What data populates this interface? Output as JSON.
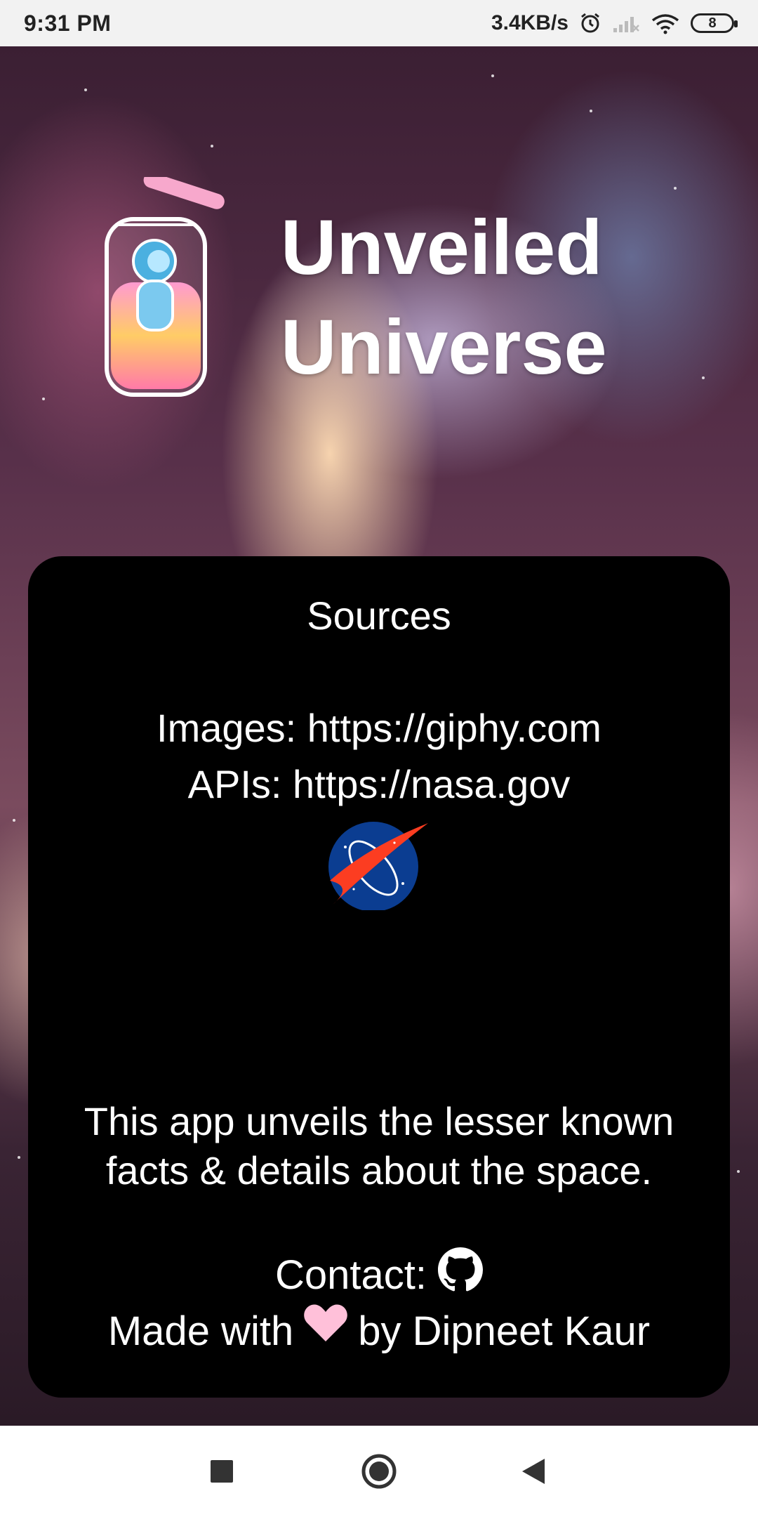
{
  "status_bar": {
    "time": "9:31 PM",
    "speed": "3.4KB/s",
    "battery": "8",
    "icons": [
      "alarm-icon",
      "signal-icon",
      "wifi-icon",
      "battery-icon"
    ]
  },
  "header": {
    "title_line1": "Unveiled",
    "title_line2": "Universe",
    "logo_icon": "astronaut-jar-logo"
  },
  "card": {
    "sources_title": "Sources",
    "images_line": "Images: https://giphy.com",
    "apis_line": "APIs: https://nasa.gov",
    "nasa_icon": "nasa-logo",
    "description": "This app unveils the lesser known facts & details about the space.",
    "contact_label": "Contact:",
    "contact_icon": "github-icon",
    "made_prefix": "Made with",
    "made_icon": "heart-icon",
    "made_suffix": "by Dipneet Kaur"
  },
  "nav_bar": {
    "buttons": [
      "recent-apps",
      "home",
      "back"
    ]
  },
  "colors": {
    "card_bg": "#000000",
    "heart": "#ffc0d9",
    "nasa_blue": "#0b3d91",
    "nasa_red": "#fc3d21"
  }
}
